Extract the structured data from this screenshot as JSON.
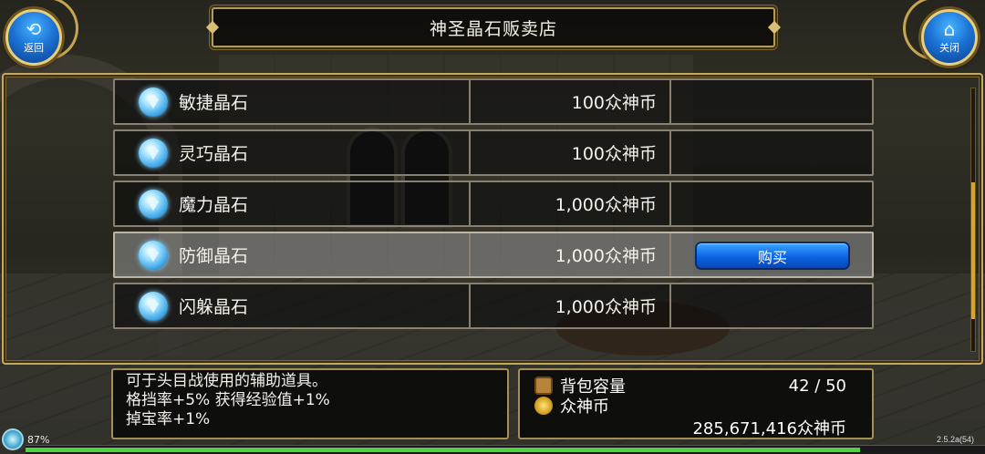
{
  "title": "神圣晶石贩卖店",
  "nav": {
    "back_label": "返回",
    "back_glyph": "⟲",
    "close_label": "关闭",
    "close_glyph": "⌂"
  },
  "items": [
    {
      "name": "敏捷晶石",
      "price": "100众神币"
    },
    {
      "name": "灵巧晶石",
      "price": "100众神币"
    },
    {
      "name": "魔力晶石",
      "price": "1,000众神币"
    },
    {
      "name": "防御晶石",
      "price": "1,000众神币",
      "selected": true
    },
    {
      "name": "闪躲晶石",
      "price": "1,000众神币"
    }
  ],
  "buy_label": "购买",
  "description": {
    "line1": "可于头目战使用的辅助道具。",
    "line2": "格挡率+5% 获得经验值+1%",
    "line3": "掉宝率+1%"
  },
  "inventory": {
    "capacity_label": "背包容量",
    "capacity_value": "42 / 50",
    "currency_label": "众神币",
    "currency_value": "285,671,416众神币"
  },
  "status": {
    "percent_label": "87%",
    "percent_value": 0.87,
    "version": "2.5.2a(54)"
  },
  "colors": {
    "gold_frame": "#c5a85e",
    "buy_button": "#0c64e3",
    "exp_bar": "#4fd23f"
  }
}
